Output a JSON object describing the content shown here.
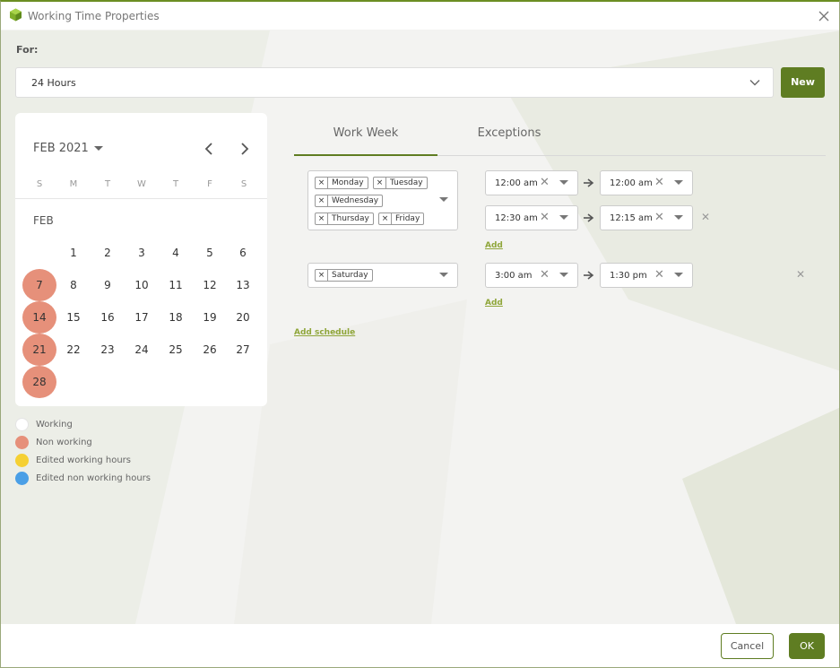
{
  "window": {
    "title": "Working Time Properties"
  },
  "form": {
    "for_label": "For:",
    "for_value": "24 Hours",
    "new_button": "New"
  },
  "calendar": {
    "month_title": "FEB 2021",
    "month_label": "FEB",
    "weekdays": [
      "S",
      "M",
      "T",
      "W",
      "T",
      "F",
      "S"
    ],
    "days": [
      "1",
      "2",
      "3",
      "4",
      "5",
      "6",
      "7",
      "8",
      "9",
      "10",
      "11",
      "12",
      "13",
      "14",
      "15",
      "16",
      "17",
      "18",
      "19",
      "20",
      "21",
      "22",
      "23",
      "24",
      "25",
      "26",
      "27",
      "28"
    ],
    "non_working_days": [
      "7",
      "14",
      "21",
      "28"
    ]
  },
  "legend": [
    {
      "label": "Working",
      "color": "#ffffff"
    },
    {
      "label": "Non working",
      "color": "#e6907a"
    },
    {
      "label": "Edited working hours",
      "color": "#f5d033"
    },
    {
      "label": "Edited non working hours",
      "color": "#4a9fe6"
    }
  ],
  "tabs": [
    {
      "label": "Work Week",
      "active": true
    },
    {
      "label": "Exceptions",
      "active": false
    }
  ],
  "schedules": [
    {
      "days": [
        "Monday",
        "Tuesday",
        "Wednesday",
        "Thursday",
        "Friday"
      ],
      "ranges": [
        {
          "from": "12:00 am",
          "to": "12:00 am"
        },
        {
          "from": "12:30 am",
          "to": "12:15 am"
        }
      ],
      "add_label": "Add"
    },
    {
      "days": [
        "Saturday"
      ],
      "ranges": [
        {
          "from": "3:00 am",
          "to": "1:30 pm"
        }
      ],
      "add_label": "Add"
    }
  ],
  "add_schedule_label": "Add schedule",
  "footer": {
    "cancel": "Cancel",
    "ok": "OK"
  },
  "colors": {
    "accent": "#5f7d22",
    "link": "#8fa63a",
    "non_working": "#e6907a"
  }
}
